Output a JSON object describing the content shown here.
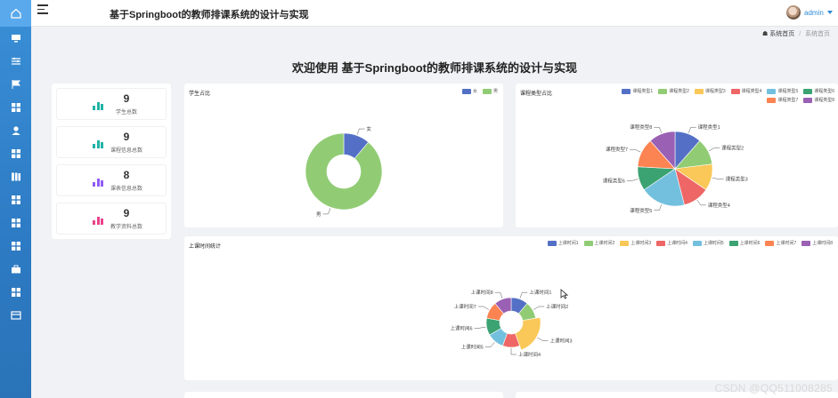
{
  "header": {
    "title": "基于Springboot的教师排课系统的设计与实现",
    "user": "admin"
  },
  "breadcrumb": {
    "home": "系统首页",
    "current": "系统首页"
  },
  "welcome": "欢迎使用 基于Springboot的教师排课系统的设计与实现",
  "sidebar": {
    "items": [
      "home-icon",
      "monitor-icon",
      "sliders-icon",
      "flag-icon",
      "grid-icon",
      "user-icon",
      "grid-icon",
      "book-icon",
      "grid-icon",
      "grid-icon",
      "grid-icon",
      "briefcase-icon",
      "grid-icon",
      "card-icon"
    ]
  },
  "stats": [
    {
      "value": "9",
      "label": "学生总数",
      "color": "#21b3a5"
    },
    {
      "value": "9",
      "label": "课程信息总数",
      "color": "#21b3a5"
    },
    {
      "value": "8",
      "label": "课表信息总数",
      "color": "#8f5cf7"
    },
    {
      "value": "9",
      "label": "教学资料总数",
      "color": "#e9428a"
    }
  ],
  "colors": {
    "accent": "#2d8ad8",
    "sidebar": "#2d7bc4"
  },
  "watermark": "CSDN @QQ511008285",
  "chart_data": [
    {
      "type": "pie",
      "variant": "donut",
      "title": "学生占比",
      "categories": [
        "女",
        "男"
      ],
      "values": [
        1,
        8
      ],
      "colors": [
        "#5470c6",
        "#91cc75"
      ],
      "legend": "top-right"
    },
    {
      "type": "pie",
      "title": "课程类型占比",
      "categories": [
        "课程类型1",
        "课程类型2",
        "课程类型3",
        "课程类型4",
        "课程类型5",
        "课程类型6",
        "课程类型7",
        "课程类型8"
      ],
      "values": [
        1,
        1,
        1,
        1,
        1.7,
        0.9,
        1.1,
        1
      ],
      "colors": [
        "#5470c6",
        "#91cc75",
        "#fac858",
        "#ee6666",
        "#73c0de",
        "#3ba272",
        "#fc8452",
        "#9a60b4"
      ],
      "legend": "top-right"
    },
    {
      "type": "pie",
      "variant": "rose-donut",
      "title": "上课时间统计",
      "categories": [
        "上课时间1",
        "上课时间2",
        "上课时间3",
        "上课时间4",
        "上课时间5",
        "上课时间6",
        "上课时间7",
        "上课时间8"
      ],
      "values": [
        1,
        1,
        2,
        1,
        1,
        1,
        1,
        1
      ],
      "colors": [
        "#5470c6",
        "#91cc75",
        "#fac858",
        "#ee6666",
        "#73c0de",
        "#3ba272",
        "#fc8452",
        "#9a60b4"
      ],
      "legend": "top-right"
    }
  ]
}
